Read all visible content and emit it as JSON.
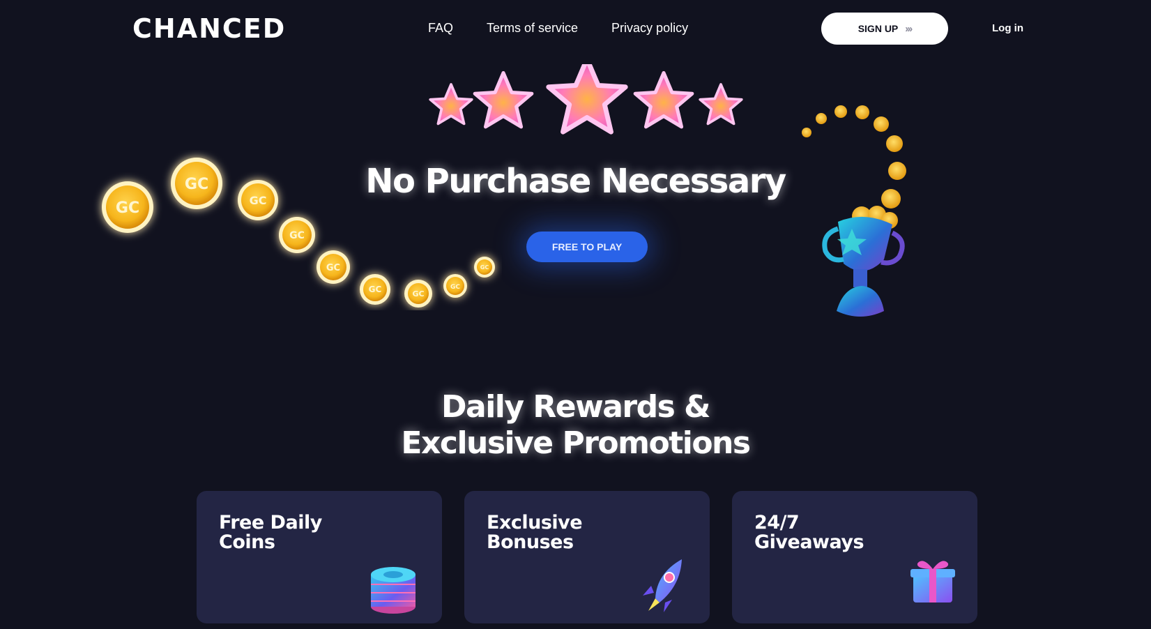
{
  "header": {
    "logo": "CHANCED",
    "nav": [
      "FAQ",
      "Terms of service",
      "Privacy policy"
    ],
    "signup_label": "SIGN UP",
    "signup_chevrons": "›››",
    "login_label": "Log in"
  },
  "hero": {
    "title": "No Purchase Necessary",
    "cta_label": "FREE TO PLAY",
    "coin_text": "GC"
  },
  "promotions": {
    "title_line1": "Daily Rewards &",
    "title_line2": "Exclusive Promotions",
    "cards": [
      {
        "line1": "Free Daily",
        "line2": "Coins"
      },
      {
        "line1": "Exclusive",
        "line2": "Bonuses"
      },
      {
        "line1": "24/7",
        "line2": "Giveaways"
      }
    ]
  },
  "colors": {
    "background": "#11121f",
    "card": "#232544",
    "accent_blue": "#2a63e8",
    "coin_gold": "#f6b51c",
    "star_pink": "#f06ad6"
  },
  "icons": [
    "star-icon",
    "gold-coin-icon",
    "trophy-icon",
    "chip-stack-icon",
    "rocket-icon",
    "gift-icon"
  ]
}
